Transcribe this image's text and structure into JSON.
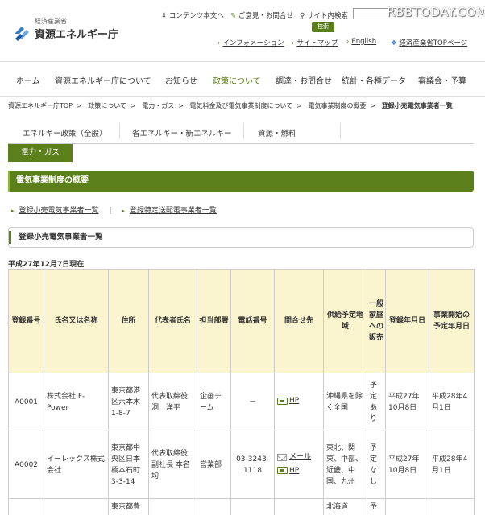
{
  "header": {
    "ministry_small": "経済産業省",
    "agency_name": "資源エネルギー庁",
    "util_links": [
      "コンテンツ本文へ",
      "ご意見・お問合せ",
      "サイト内検索"
    ],
    "search_button": "検索",
    "watermark": "RBBTODAY.COM",
    "sub_links": [
      "インフォメーション",
      "サイトマップ",
      "English",
      "経済産業省TOPページ"
    ]
  },
  "nav": {
    "items": [
      "ホーム",
      "資源エネルギー庁について",
      "お知らせ",
      "政策について",
      "調達・お問合せ",
      "統計・各種データ",
      "審議会・予算"
    ],
    "active_index": 3
  },
  "breadcrumb": {
    "items": [
      "資源エネルギー庁TOP",
      "政策について",
      "電力・ガス",
      "電気料金及び電気事業制度について",
      "電気事業制度の概要"
    ],
    "current": "登録小売電気事業者一覧"
  },
  "tabs": {
    "items": [
      "エネルギー政策（全般）",
      "省エネルギー・新エネルギー",
      "資源・燃料"
    ],
    "active_subtab": "電力・ガス"
  },
  "section_title": "電気事業制度の概要",
  "links": [
    "登録小売電気事業者一覧",
    "登録特定送配電事業者一覧"
  ],
  "subsection_title": "登録小売電気事業者一覧",
  "as_of_date": "平成27年12月7日現在",
  "table": {
    "headers": [
      "登録番号",
      "氏名又は名称",
      "住所",
      "代表者氏名",
      "担当部署",
      "電話番号",
      "問合せ先",
      "供給予定地域",
      "一般家庭への販売",
      "登録年月日",
      "事業開始の予定年月日"
    ],
    "rows": [
      {
        "id": "A0001",
        "name": "株式会社 F-Power",
        "address": "東京都港区六本木1-8-7",
        "representative": "代表取締役 洞　洋平",
        "department": "企画チーム",
        "phone": "－",
        "contact_mail": "",
        "contact_hp": "HP",
        "area": "沖縄県を除く全国",
        "household": "予定あり",
        "registered": "平成27年10月8日",
        "start": "平成28年4月1日"
      },
      {
        "id": "A0002",
        "name": "イーレックス株式会社",
        "address": "東京都中央区日本橋本石町3-3-14",
        "representative": "代表取締役副社長 本名　均",
        "department": "営業部",
        "phone": "03-3243-1118",
        "contact_mail": "メール",
        "contact_hp": "HP",
        "area": "東北、関東、中部、近畿、中国、九州",
        "household": "予定なし",
        "registered": "平成27年10月8日",
        "start": "平成28年4月1日"
      },
      {
        "id": "",
        "name": "",
        "address": "東京都豊",
        "representative": "",
        "department": "",
        "phone": "",
        "contact_mail": "",
        "contact_hp": "",
        "area": "北海道",
        "household": "予",
        "registered": "",
        "start": ""
      }
    ]
  },
  "colors": {
    "brand_green": "#5b7f1b",
    "header_yellow": "#fbf5cf"
  }
}
